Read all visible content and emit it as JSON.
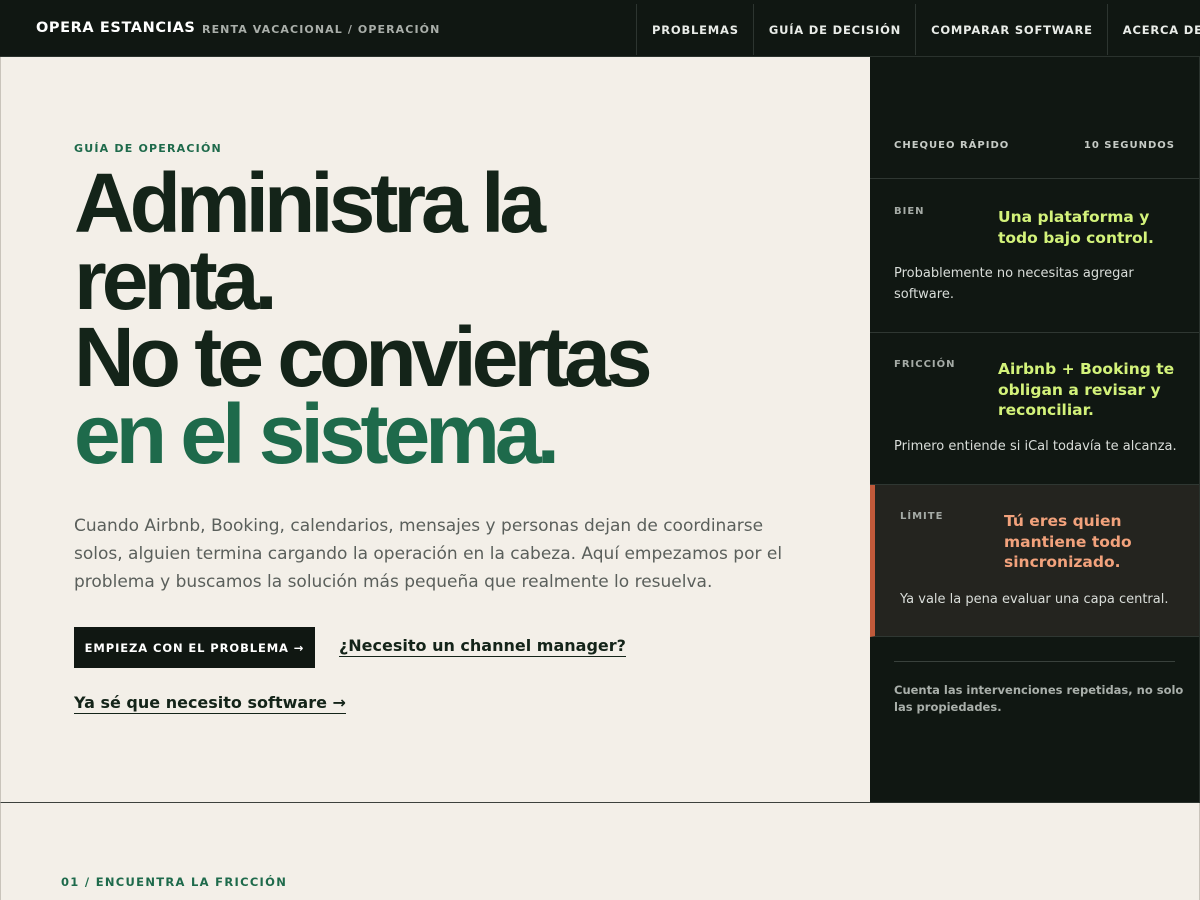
{
  "header": {
    "brand": "OPERA ESTANCIAS",
    "tagline": "RENTA VACACIONAL / OPERACIÓN",
    "nav": [
      {
        "label": "PROBLEMAS"
      },
      {
        "label": "GUÍA DE DECISIÓN"
      },
      {
        "label": "COMPARAR SOFTWARE"
      },
      {
        "label": "ACERCA DE"
      }
    ]
  },
  "hero": {
    "eyebrow": "GUÍA DE OPERACIÓN",
    "headline": {
      "line1": "Administra la",
      "line2": "renta.",
      "line3": "No te conviertas",
      "line4": "en el sistema."
    },
    "lede": {
      "line1": "Cuando Airbnb, Booking, calendarios, mensajes y personas dejan de coordinarse",
      "line2": "solos, alguien termina cargando la operación en la cabeza. Aquí empezamos por el",
      "line3": "problema y buscamos la solución más pequeña que realmente lo resuelva."
    },
    "cta_primary": "EMPIEZA CON EL PROBLEMA →",
    "cta_secondary": "¿Necesito un channel manager?",
    "cta_tertiary": "Ya sé que necesito software →"
  },
  "quick_check": {
    "title": "CHEQUEO RÁPIDO",
    "duration": "10 SEGUNDOS",
    "rows": [
      {
        "tag": "BIEN",
        "title": "Una plataforma y todo bajo control.",
        "text": "Probablemente no necesitas agregar software."
      },
      {
        "tag": "FRICCIÓN",
        "title": "Airbnb + Booking te obligan a revisar y reconciliar.",
        "text": "Primero entiende si iCal todavía te alcanza."
      },
      {
        "tag": "LÍMITE",
        "title": "Tú eres quien mantiene todo sincronizado.",
        "text": "Ya vale la pena evaluar una capa central."
      }
    ],
    "footnote": "Cuenta las intervenciones repetidas, no solo las propiedades."
  },
  "section2": {
    "label": "01 / ENCUENTRA LA FRICCIÓN"
  },
  "colors": {
    "dark": "#101712",
    "cream": "#f3efe8",
    "green_accent": "#1e6a4b",
    "lime": "#d3f27a",
    "salmon": "#f2a27c",
    "limit_bar": "#c0593a"
  }
}
